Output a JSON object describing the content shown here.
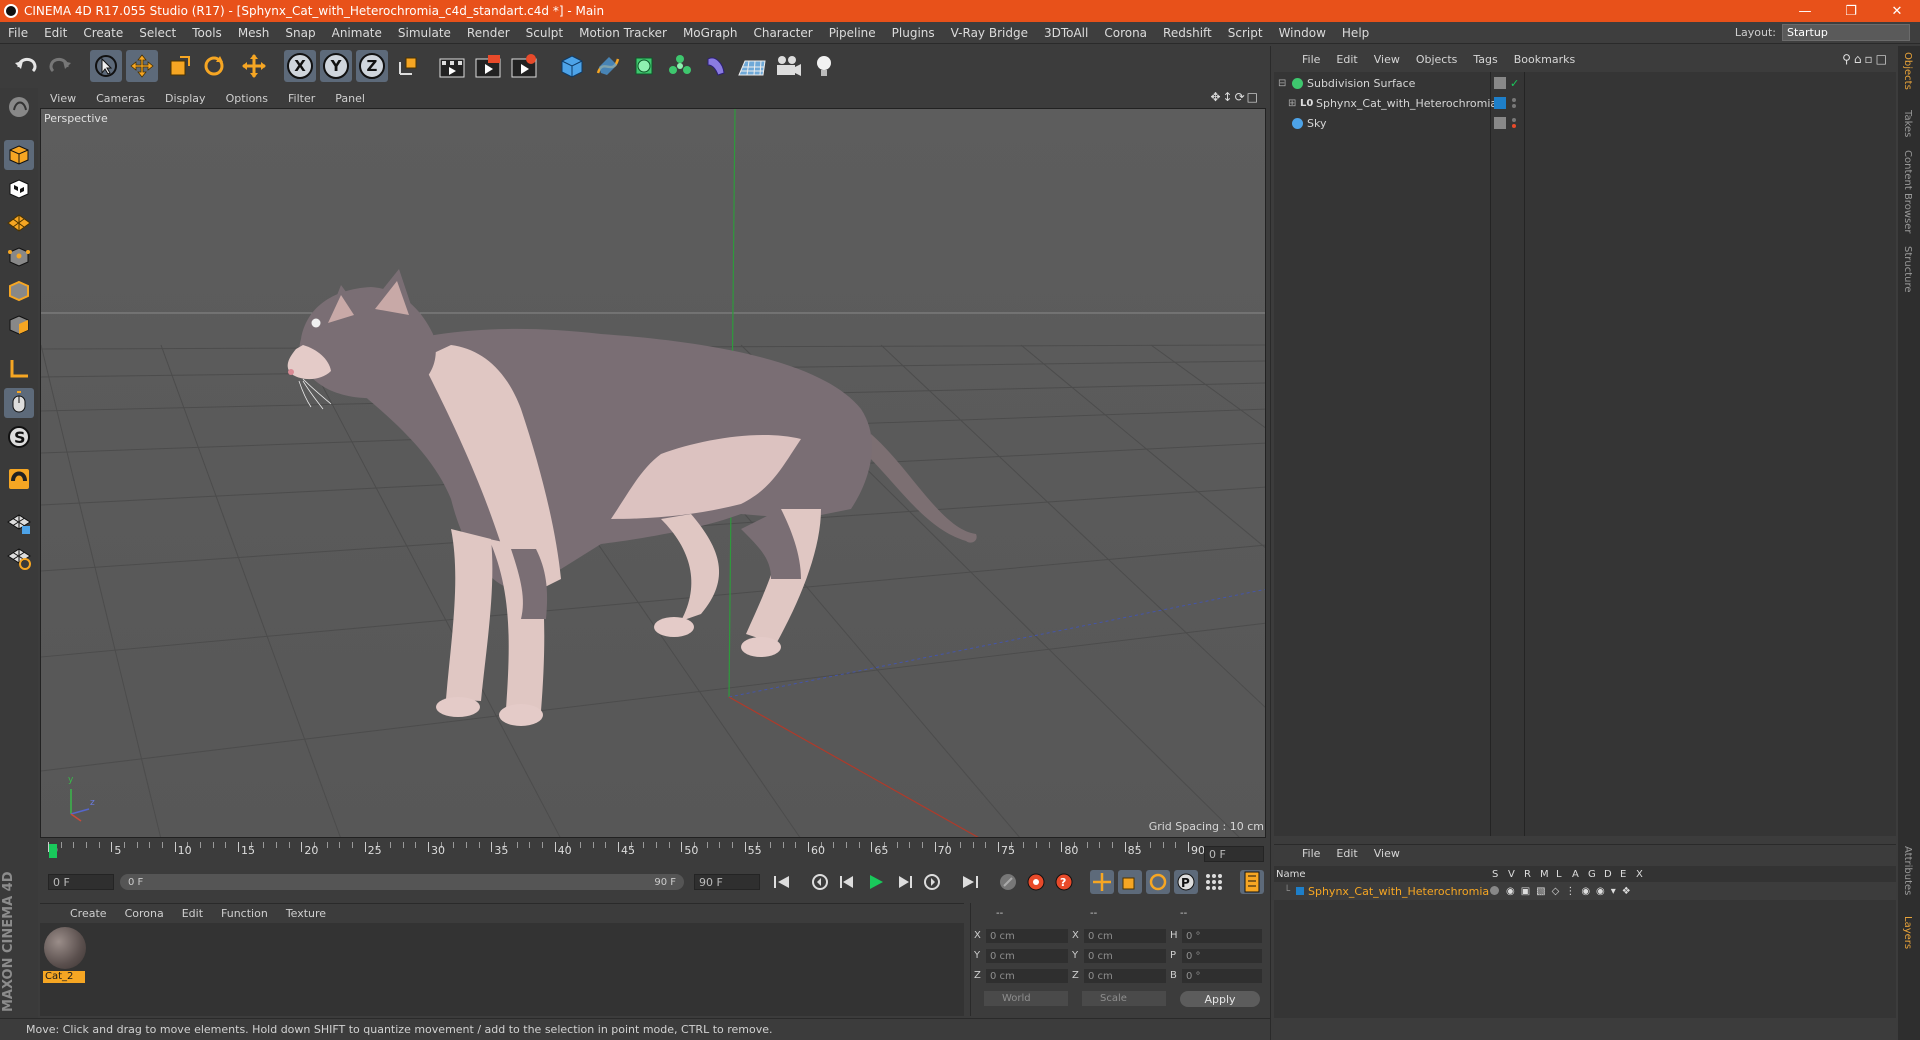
{
  "window": {
    "title": "CINEMA 4D R17.055 Studio (R17) - [Sphynx_Cat_with_Heterochromia_c4d_standart.c4d *] - Main",
    "controls": [
      "minimize-icon",
      "restore-icon",
      "close-icon"
    ]
  },
  "menubar": {
    "items": [
      "File",
      "Edit",
      "Create",
      "Select",
      "Tools",
      "Mesh",
      "Snap",
      "Animate",
      "Simulate",
      "Render",
      "Sculpt",
      "Motion Tracker",
      "MoGraph",
      "Character",
      "Pipeline",
      "Plugins",
      "V-Ray Bridge",
      "3DToAll",
      "Corona",
      "Redshift",
      "Script",
      "Window",
      "Help"
    ],
    "layout_label": "Layout:",
    "layout_value": "Startup"
  },
  "toolbar": {
    "axis_x": "X",
    "axis_y": "Y",
    "axis_z": "Z"
  },
  "viewport": {
    "menu": [
      "View",
      "Cameras",
      "Display",
      "Options",
      "Filter",
      "Panel"
    ],
    "label": "Perspective",
    "grid_spacing": "Grid Spacing : 10 cm",
    "axis_y_label": "y",
    "axis_z_label": "z"
  },
  "timeline": {
    "ticks": [
      "0",
      "5",
      "10",
      "15",
      "20",
      "25",
      "30",
      "35",
      "40",
      "45",
      "50",
      "55",
      "60",
      "65",
      "70",
      "75",
      "80",
      "85",
      "90"
    ],
    "current_frame": "0 F",
    "start_frame": "0 F",
    "scrub_start": "0 F",
    "scrub_end": "90 F",
    "end_frame": "90 F"
  },
  "materials": {
    "menu": [
      "Create",
      "Corona",
      "Edit",
      "Function",
      "Texture"
    ],
    "items": [
      {
        "name": "Cat_2"
      }
    ]
  },
  "coordinates": {
    "header_left": "--",
    "header_mid": "--",
    "header_right": "--",
    "rows": [
      {
        "a": "X",
        "av": "0 cm",
        "b": "X",
        "bv": "0 cm",
        "c": "H",
        "cv": "0 °"
      },
      {
        "a": "Y",
        "av": "0 cm",
        "b": "Y",
        "bv": "0 cm",
        "c": "P",
        "cv": "0 °"
      },
      {
        "a": "Z",
        "av": "0 cm",
        "b": "Z",
        "bv": "0 cm",
        "c": "B",
        "cv": "0 °"
      }
    ],
    "space": "World",
    "mode": "Scale",
    "apply": "Apply"
  },
  "status": {
    "text": "Move: Click and drag to move elements. Hold down SHIFT to quantize movement / add to the selection in point mode, CTRL to remove."
  },
  "branding": {
    "logo": "MAXON CINEMA 4D"
  },
  "object_manager": {
    "menu": [
      "File",
      "Edit",
      "View",
      "Objects",
      "Tags",
      "Bookmarks"
    ],
    "objects": [
      {
        "name": "Subdivision Surface"
      },
      {
        "name": "Sphynx_Cat_with_Heterochromia"
      },
      {
        "name": "Sky"
      }
    ]
  },
  "layer_manager": {
    "menu": [
      "File",
      "Edit",
      "View"
    ],
    "columns": [
      "Name",
      "S",
      "V",
      "R",
      "M",
      "L",
      "A",
      "G",
      "D",
      "E",
      "X"
    ],
    "layers": [
      {
        "name": "Sphynx_Cat_with_Heterochromia"
      }
    ]
  },
  "side_tabs": [
    "Objects",
    "Takes",
    "Content Browser",
    "Structure",
    "Attributes",
    "Layers"
  ],
  "colors": {
    "titlebar": "#e8511a",
    "accent_highlight": "#f6a623",
    "viewport_bg": "#5b5b5b",
    "layer_color": "#1e7fc9"
  }
}
